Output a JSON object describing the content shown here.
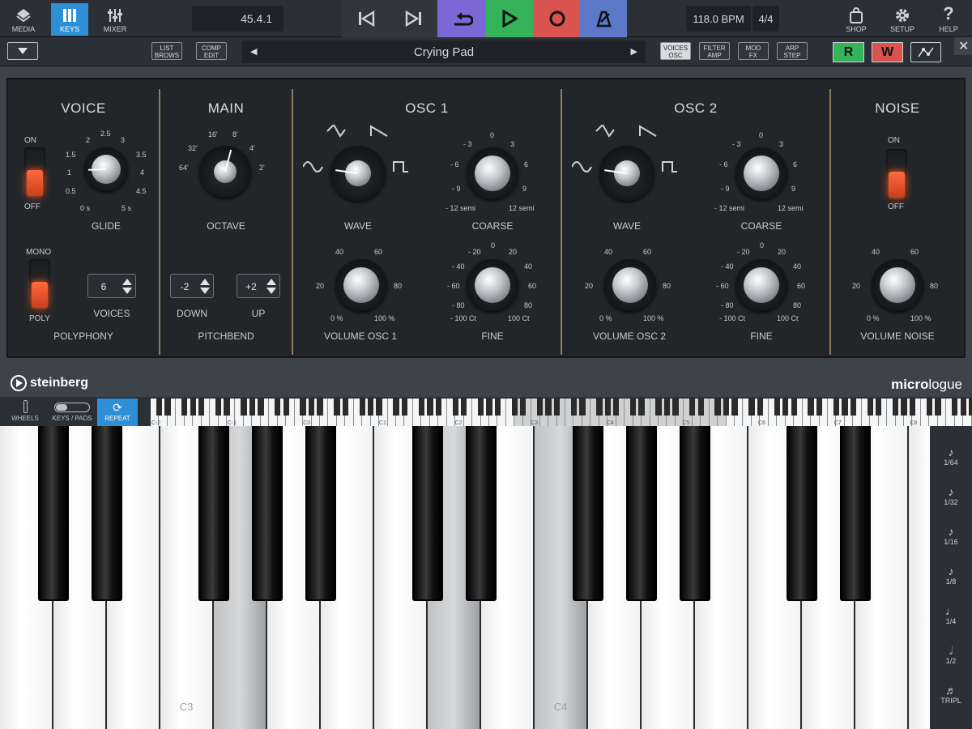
{
  "topbar": {
    "media_label": "MEDIA",
    "keys_label": "KEYS",
    "mixer_label": "MIXER",
    "position": "45.4.1",
    "tempo": "118.0 BPM",
    "signature": "4/4",
    "shop_label": "SHOP",
    "setup_label": "SETUP",
    "help_label": "HELP",
    "colors": {
      "loop": "#7b68d6",
      "play": "#35b35a",
      "record": "#d9534f",
      "metronome": "#5b78c9",
      "active_tab": "#2e8fd6"
    }
  },
  "toolbar": {
    "list_browse": [
      "LIST",
      "BROWS"
    ],
    "comp_edit": [
      "COMP",
      "EDIT"
    ],
    "preset_name": "Crying Pad",
    "voices_osc": [
      "VOICES",
      "OSC"
    ],
    "filter_amp": [
      "FILTER",
      "AMP"
    ],
    "mod_fx": [
      "MOD",
      "FX"
    ],
    "arp_step": [
      "ARP",
      "STEP"
    ],
    "read_label": "R",
    "write_label": "W"
  },
  "synth": {
    "voice": {
      "title": "VOICE",
      "on_label": "ON",
      "off_label": "OFF",
      "glide_label": "GLIDE",
      "glide_ticks": [
        "0 s",
        "0.5",
        "1",
        "1.5",
        "2",
        "2.5",
        "3",
        "3.5",
        "4",
        "4.5",
        "5 s"
      ],
      "mono_label": "MONO",
      "poly_label": "POLY",
      "voices_value": "6",
      "voices_label": "VOICES",
      "polyphony_label": "POLYPHONY"
    },
    "main": {
      "title": "MAIN",
      "octave_label": "OCTAVE",
      "octave_ticks": [
        "64'",
        "32'",
        "16'",
        "8'",
        "4'",
        "2'"
      ],
      "down_value": "-2",
      "down_label": "DOWN",
      "up_value": "+2",
      "up_label": "UP",
      "pitchbend_label": "PITCHBEND"
    },
    "osc1": {
      "title": "OSC 1",
      "wave_label": "WAVE",
      "coarse_label": "COARSE",
      "coarse_ticks": [
        "- 3",
        "0",
        "3",
        "- 6",
        "6",
        "- 9",
        "9",
        "- 12 semi",
        "12 semi"
      ],
      "volume_label": "VOLUME OSC 1",
      "volume_ticks": [
        "40",
        "60",
        "20",
        "80",
        "0 %",
        "100 %"
      ],
      "fine_label": "FINE",
      "fine_ticks": [
        "0",
        "- 20",
        "20",
        "- 40",
        "40",
        "- 60",
        "60",
        "- 80",
        "80",
        "- 100 Ct",
        "100 Ct"
      ]
    },
    "osc2": {
      "title": "OSC 2",
      "wave_label": "WAVE",
      "coarse_label": "COARSE",
      "volume_label": "VOLUME OSC 2",
      "fine_label": "FINE"
    },
    "noise": {
      "title": "NOISE",
      "on_label": "ON",
      "off_label": "OFF",
      "volume_label": "VOLUME NOISE"
    },
    "brand_left": "steinberg",
    "brand_right_bold": "micro",
    "brand_right_light": "logue"
  },
  "keyboard": {
    "wheels_label": "WHEELS",
    "keys_pads_label": "KEYS / PADS",
    "repeat_label": "REPEAT",
    "mini_labels": [
      "C-2",
      "C-1",
      "C0",
      "C1",
      "C2",
      "C3",
      "C4",
      "C5",
      "C6",
      "C7",
      "C8"
    ],
    "c3_label": "C3",
    "c4_label": "C4"
  },
  "note_repeat": [
    {
      "symbol": "♪",
      "label": "1/64"
    },
    {
      "symbol": "♪",
      "label": "1/32"
    },
    {
      "symbol": "♪",
      "label": "1/16"
    },
    {
      "symbol": "♪",
      "label": "1/8"
    },
    {
      "symbol": "♩",
      "label": "1/4"
    },
    {
      "symbol": "𝅗𝅥",
      "label": "1/2"
    },
    {
      "symbol": "♬",
      "label": "TRIPL"
    }
  ]
}
